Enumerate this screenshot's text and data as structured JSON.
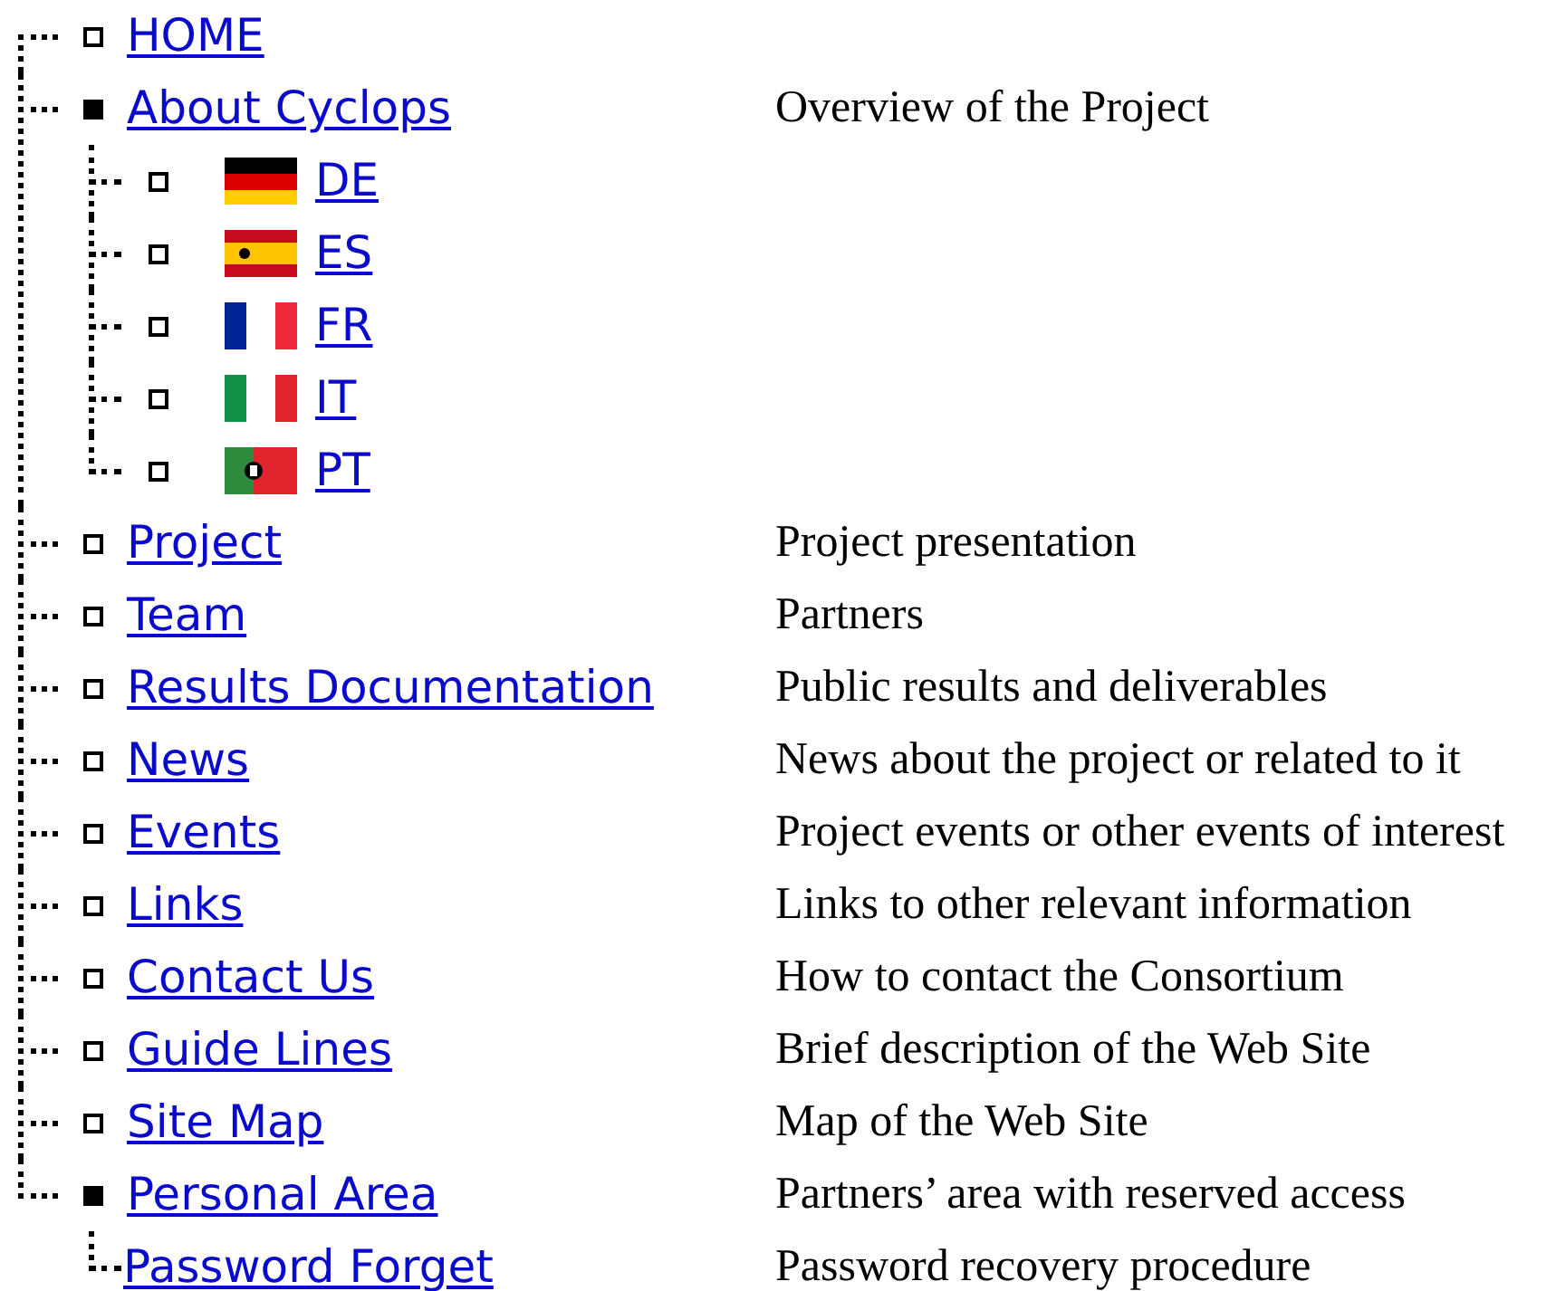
{
  "tree": [
    {
      "label": "HOME",
      "expanded": false
    },
    {
      "label": "About Cyclops",
      "description": "Overview of the Project",
      "expanded": true,
      "children": [
        {
          "label": "DE",
          "kind": "de"
        },
        {
          "label": "ES",
          "kind": "es"
        },
        {
          "label": "FR",
          "kind": "fr"
        },
        {
          "label": "IT",
          "kind": "it"
        },
        {
          "label": "PT",
          "kind": "pt"
        }
      ]
    },
    {
      "label": "Project",
      "description": "Project presentation",
      "expanded": false
    },
    {
      "label": "Team",
      "description": "Partners",
      "expanded": false
    },
    {
      "label": "Results Documentation",
      "description": "Public results and deliverables",
      "expanded": false
    },
    {
      "label": "News",
      "description": "News about the project or related to it",
      "expanded": false
    },
    {
      "label": "Events",
      "description": "Project events or other events of interest",
      "expanded": false
    },
    {
      "label": "Links",
      "description": "Links to other relevant information",
      "expanded": false
    },
    {
      "label": "Contact Us",
      "description": "How to contact the Consortium",
      "expanded": false
    },
    {
      "label": "Guide Lines",
      "description": "Brief description of the Web Site",
      "expanded": false
    },
    {
      "label": "Site Map",
      "description": "Map of the Web Site",
      "expanded": false
    },
    {
      "label": "Personal Area",
      "description": "Partners’ area with reserved access",
      "expanded": true,
      "children": [
        {
          "label": "Password Forget",
          "description": "Password recovery procedure",
          "kind": "plain"
        }
      ]
    }
  ]
}
